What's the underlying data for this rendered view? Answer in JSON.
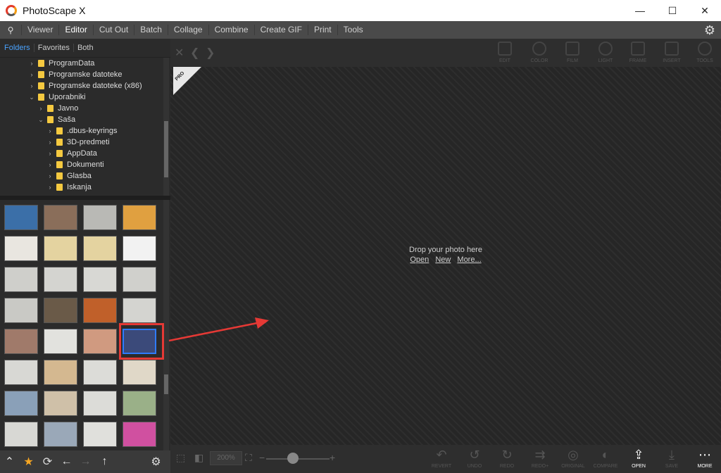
{
  "window": {
    "title": "PhotoScape X",
    "minimize": "—",
    "maximize": "☐",
    "close": "✕"
  },
  "menu": {
    "search_icon": "⚲",
    "items": [
      "Viewer",
      "Editor",
      "Cut Out",
      "Batch",
      "Collage",
      "Combine",
      "Create GIF",
      "Print",
      "Tools"
    ],
    "active": "Editor",
    "settings_icon": "⚙"
  },
  "folder_tabs": [
    "Folders",
    "Favorites",
    "Both"
  ],
  "tree": [
    {
      "label": "ProgramData",
      "indent": 0,
      "expanded": false
    },
    {
      "label": "Programske datoteke",
      "indent": 0,
      "expanded": false
    },
    {
      "label": "Programske datoteke (x86)",
      "indent": 0,
      "expanded": false
    },
    {
      "label": "Uporabniki",
      "indent": 0,
      "expanded": true
    },
    {
      "label": "Javno",
      "indent": 1,
      "expanded": false
    },
    {
      "label": "Saša",
      "indent": 1,
      "expanded": true
    },
    {
      "label": ".dbus-keyrings",
      "indent": 2,
      "expanded": false
    },
    {
      "label": "3D-predmeti",
      "indent": 2,
      "expanded": false
    },
    {
      "label": "AppData",
      "indent": 2,
      "expanded": false
    },
    {
      "label": "Dokumenti",
      "indent": 2,
      "expanded": false
    },
    {
      "label": "Glasba",
      "indent": 2,
      "expanded": false
    },
    {
      "label": "Iskanja",
      "indent": 2,
      "expanded": false
    }
  ],
  "left_toolbar": {
    "up": "⌃",
    "star": "★",
    "refresh": "⟳",
    "back": "←",
    "forward": "→",
    "parent": "↑",
    "settings": "⚙"
  },
  "top_tools": [
    "EDIT",
    "COLOR",
    "FILM",
    "LIGHT",
    "FRAME",
    "INSERT",
    "TOOLS"
  ],
  "canvas": {
    "badge": "PRO",
    "drop_text": "Drop your photo here",
    "links": [
      "Open",
      "New",
      "More..."
    ]
  },
  "bottom": {
    "zoom": "200%",
    "minus": "−",
    "plus": "+",
    "tools": [
      "REVERT",
      "UNDO",
      "REDO",
      "REDO+",
      "ORIGINAL",
      "COMPARE",
      "OPEN",
      "SAVE",
      "MORE"
    ]
  },
  "thumb_colors": [
    [
      "#3b6fa8",
      "#8a6e5a",
      "#b9b9b5",
      "#e0a040"
    ],
    [
      "#e9e6e0",
      "#e4d3a0",
      "#e4d3a0",
      "#f2f2f2"
    ],
    [
      "#cfcfcb",
      "#d4d4d0",
      "#d8d8d4",
      "#d0d0cc"
    ],
    [
      "#c9c9c5",
      "#6a5a48",
      "#c0602a",
      "#d4d4d0"
    ],
    [
      "#a07a6a",
      "#e2e2de",
      "#d09a80",
      "#3b4a7a"
    ],
    [
      "#d8d8d4",
      "#d4b890",
      "#dcdcd8",
      "#e0d8c8"
    ],
    [
      "#8aa0b8",
      "#cfc0a8",
      "#dcdcd8",
      "#9ab088"
    ],
    [
      "#d8d8d4",
      "#9aa8b8",
      "#e0e0dc",
      "#d050a0"
    ]
  ]
}
